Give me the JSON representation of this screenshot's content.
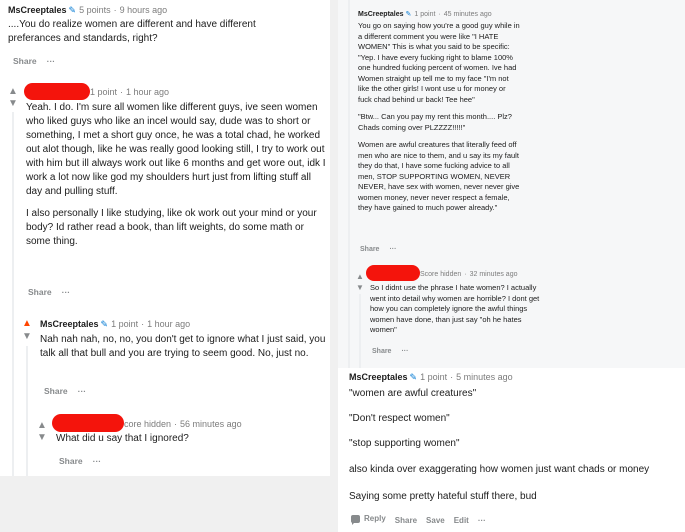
{
  "left": {
    "top_comment": {
      "author": "MsCreeptales",
      "score": "5 points",
      "time": "9 hours ago",
      "lines": [
        "....You do realize women are different and have different",
        "preferances and standards, right?"
      ],
      "share": "Share",
      "more": "···"
    },
    "reply_1": {
      "score": "1 point",
      "time": "1 hour ago",
      "paragraphs": [
        "Yeah. I do. I'm sure all women like different guys, ive seen women who liked guys who like an incel would say, dude was to short or something, I met a short guy once, he was a total chad, he worked out alot though, like he was really good looking still, I try to work out with him but ill always work out like 6 months and get wore out, idk I work a lot now like god my shoulders hurt just from lifting stuff all day and pulling stuff.",
        "I also personally I like studying, like ok work out your mind or your body? Id rather read a book, than lift weights, do some math or some thing."
      ],
      "share": "Share",
      "more": "···"
    },
    "reply_2": {
      "author": "MsCreeptales",
      "score": "1 point",
      "time": "1 hour ago",
      "text": "Nah nah nah, no, no, you don't get to ignore what I just said, you talk all that bull and you are trying to seem good. No, just no.",
      "share": "Share",
      "more": "···"
    },
    "reply_3": {
      "score": "core hidden",
      "time": "56 minutes ago",
      "text": "What did u say that I ignored?",
      "share": "Share",
      "more": "···"
    }
  },
  "right_top": {
    "comment": {
      "author": "MsCreeptales",
      "score": "1 point",
      "time": "45 minutes ago",
      "paragraphs": [
        "You go on saying how you're a good guy while in a different comment you were like \"I HATE WOMEN\" This is what you said to be specific: \"Yep. I have every fucking right to blame 100% one hundred fucking percent of women. Ive had Women straight up tell me to my face \"I'm not like the other girls! I wont use u for money or fuck chad behind ur back! Tee hee\"",
        "\"Btw... Can you pay my rent this month.... Plz? Chads coming over PLZZZZ!!!!!\"",
        "Women are awful creatures that literally feed off men who are nice to them, and u say its my fault they do that, I have some fucking advice to all men, STOP SUPPORTING WOMEN, NEVER NEVER, have sex with women, never never give women money, never never respect a female, they have gained to much power already.\""
      ],
      "share": "Share",
      "more": "···"
    },
    "reply": {
      "score": "Score hidden",
      "time": "32 minutes ago",
      "text": "So I didnt use the phrase I hate women? I actually went into detail why women are horrible? I dont get how you can completely ignore the awful things women have done, than just say \"oh he hates women\"",
      "share": "Share",
      "more": "···"
    }
  },
  "right_bottom": {
    "author": "MsCreeptales",
    "score": "1 point",
    "time": "5 minutes ago",
    "lines": [
      "\"women are awful creatures\"",
      "\"Don't respect women\"",
      "\"stop supporting women\"",
      "also kinda over exaggerating how women just want chads or money",
      "Saying some pretty hateful stuff there, bud"
    ],
    "actions": {
      "reply": "Reply",
      "share": "Share",
      "save": "Save",
      "edit": "Edit",
      "more": "···"
    }
  },
  "colors": {
    "upvote_active": "#ff4500",
    "redaction": "#f4140c",
    "flair_blue": "#0079d3"
  },
  "icons": {
    "flair": "pencil-icon",
    "upvote": "up-arrow-icon",
    "downvote": "down-arrow-icon",
    "reply": "chat-bubble-icon"
  }
}
